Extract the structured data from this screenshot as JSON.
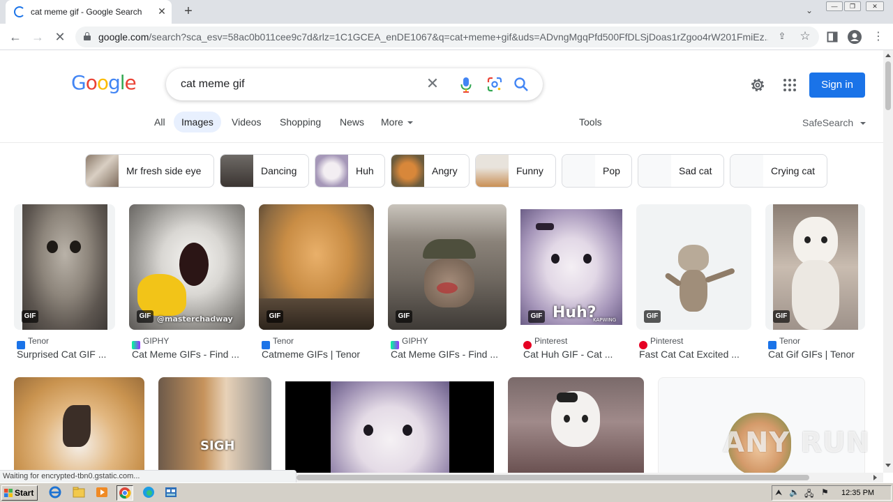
{
  "browser": {
    "tab_title": "cat meme gif - Google Search",
    "url_domain": "google.com",
    "url_path": "/search?sca_esv=58ac0b011cee9c7d&rlz=1C1GCEA_enDE1067&q=cat+meme+gif&uds=ADvngMgqPfd500FfDLSjDoas1rZgoo4rW201FmiEz..."
  },
  "search": {
    "query": "cat meme gif",
    "sign_in": "Sign in"
  },
  "tabs": [
    "All",
    "Images",
    "Videos",
    "Shopping",
    "News",
    "More"
  ],
  "tools": "Tools",
  "safesearch": "SafeSearch",
  "chips": [
    "Mr fresh side eye",
    "Dancing",
    "Huh",
    "Angry",
    "Funny",
    "Pop",
    "Sad cat",
    "Crying cat"
  ],
  "results": [
    {
      "badge": "GIF",
      "source": "Tenor",
      "title": "Surprised Cat GIF ..."
    },
    {
      "badge": "GIF",
      "source": "GIPHY",
      "title": "Cat Meme GIFs - Find ...",
      "overlay": "@masterchadway"
    },
    {
      "badge": "GIF",
      "source": "Tenor",
      "title": "Catmeme GIFs | Tenor"
    },
    {
      "badge": "GIF",
      "source": "GIPHY",
      "title": "Cat Meme GIFs - Find ..."
    },
    {
      "badge": "GIF",
      "source": "Pinterest",
      "title": "Cat Huh GIF - Cat ...",
      "overlay": "Huh?",
      "overlay2": "KAPWING"
    },
    {
      "badge": "GIF",
      "source": "Pinterest",
      "title": "Fast Cat Cat Excited ..."
    },
    {
      "badge": "GIF",
      "source": "Tenor",
      "title": "Cat Gif GIFs | Tenor"
    }
  ],
  "row2_overlay": "SIGH",
  "status": "Waiting for encrypted-tbn0.gstatic.com...",
  "taskbar": {
    "start": "Start",
    "clock": "12:35 PM"
  },
  "watermark": "ANY RUN",
  "colors": {
    "accent": "#1a73e8",
    "tab_active_bg": "#e8f0fe"
  }
}
